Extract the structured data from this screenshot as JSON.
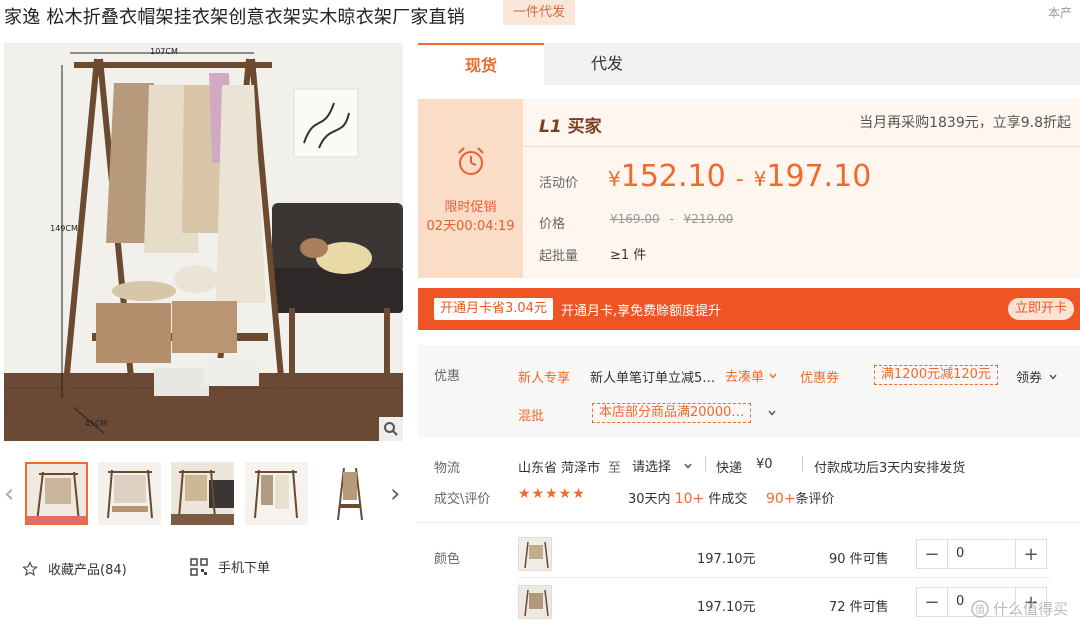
{
  "product": {
    "title": "家逸 松木折叠衣帽架挂衣架创意衣架实木晾衣架厂家直销",
    "tag": "一件代发",
    "corner_note": "本产"
  },
  "gallery": {
    "dim_width": "107CM",
    "dim_height": "149CM",
    "dim_depth": "45CM",
    "favorite_label": "收藏产品(84)",
    "mobile_label": "手机下单"
  },
  "tabs": [
    {
      "label": "现货"
    },
    {
      "label": "代发"
    }
  ],
  "promo": {
    "timer_title": "限时促销",
    "timer_value": "02天00:04:19",
    "buyer_level_badge": "L1",
    "buyer_level_text": "买家",
    "monthly_note": "当月再采购1839元，立享9.8折起",
    "activity_label": "活动价",
    "price_low": "152.10",
    "price_high": "197.10",
    "currency": "¥",
    "price_sep": "-",
    "orig_label": "价格",
    "orig_low": "¥169.00",
    "orig_high": "¥219.00",
    "min_label": "起批量",
    "min_value": "≥1 件"
  },
  "vip": {
    "tag": "开通月卡省3.04元",
    "text": "开通月卡,享免费赊额度提升",
    "button": "立即开卡"
  },
  "offers": {
    "label": "优惠",
    "newcomer_label": "新人专享",
    "newcomer_text": "新人单笔订单立减5…",
    "go_label": "去凑单",
    "coupon_label": "优惠券",
    "coupon_value": "满1200元减120元",
    "claim_label": "领券",
    "mix_label": "混批",
    "mix_value": "本店部分商品满20000…"
  },
  "logistics": {
    "label": "物流",
    "origin": "山东省 菏泽市",
    "to": "至",
    "select": "请选择",
    "express": "快递",
    "fee": "¥0",
    "ship_note": "付款成功后3天内安排发货"
  },
  "reviews": {
    "label": "成交\\评价",
    "stars": "★★★★★",
    "deals_prefix": "30天内",
    "deals_count": "10+",
    "deals_suffix": "件成交",
    "review_count": "90+",
    "review_suffix": "条评价"
  },
  "sku": {
    "label": "颜色",
    "rows": [
      {
        "price": "197.10元",
        "stock": "90 件可售",
        "qty": "0"
      },
      {
        "price": "197.10元",
        "stock": "72 件可售",
        "qty": "0"
      }
    ]
  },
  "watermark": "什么值得买",
  "colors": {
    "accent": "#f06a2b",
    "vip_bar": "#ef5524",
    "promo_bg": "#fff7ef",
    "promo_left": "#fbdcc6"
  },
  "icons": [
    "zoom-icon",
    "chevron-left-icon",
    "chevron-right-icon",
    "star-outline-icon",
    "qrcode-icon",
    "alarm-clock-icon",
    "chevron-down-icon",
    "minus-icon",
    "plus-icon"
  ]
}
